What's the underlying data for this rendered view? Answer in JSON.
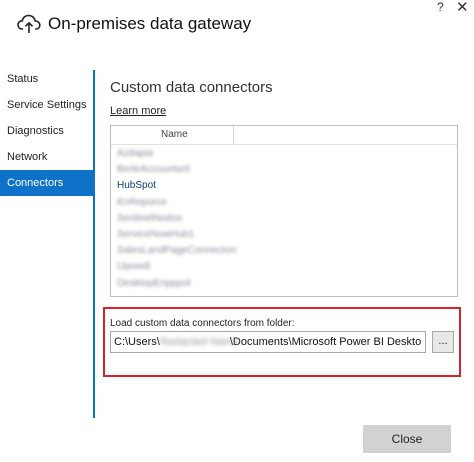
{
  "window": {
    "title": "On-premises data gateway",
    "help_label": "?",
    "close_label": "✕"
  },
  "sidebar": {
    "items": [
      {
        "label": "Status"
      },
      {
        "label": "Service Settings"
      },
      {
        "label": "Diagnostics"
      },
      {
        "label": "Network"
      },
      {
        "label": "Connectors",
        "active": true
      }
    ]
  },
  "main": {
    "title": "Custom data connectors",
    "learn_more": "Learn more",
    "list": {
      "column_header": "Name",
      "rows": [
        {
          "label": "Azdapia",
          "blurred": true
        },
        {
          "label": "BerleAccountsrit",
          "blurred": true
        },
        {
          "label": "HubSpot",
          "blurred": false
        },
        {
          "label": "KnReporce",
          "blurred": true
        },
        {
          "label": "SentinelNodos",
          "blurred": true
        },
        {
          "label": "ServiceNowHub1",
          "blurred": true
        },
        {
          "label": "SalesLandPageConnectorr",
          "blurred": true
        },
        {
          "label": "Upowdi",
          "blurred": true
        },
        {
          "label": "DesktopEnpppol",
          "blurred": true
        }
      ]
    },
    "folder": {
      "label": "Load custom data connectors from folder:",
      "path_prefix": "C:\\Users\\",
      "path_hidden": "Redacted Name",
      "path_suffix": "\\Documents\\Microsoft Power BI Deskto",
      "browse_label": "..."
    }
  },
  "footer": {
    "close_label": "Close"
  },
  "colors": {
    "accent": "#0e72c8",
    "highlight_border": "#d9232b"
  }
}
